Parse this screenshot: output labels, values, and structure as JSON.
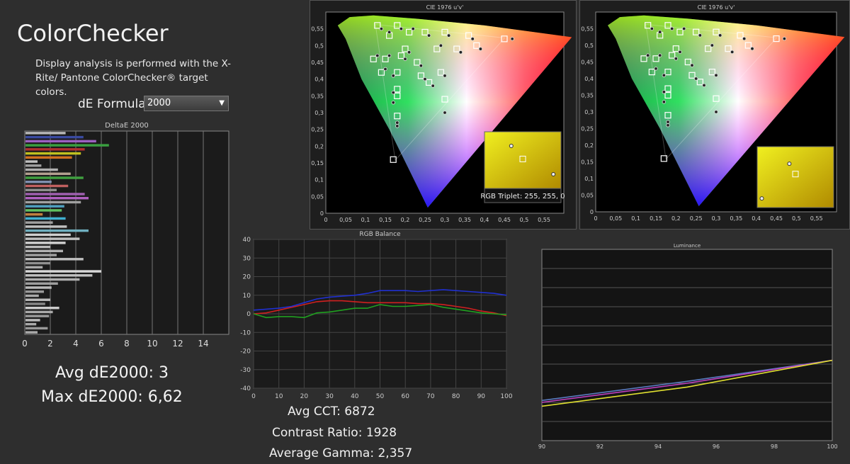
{
  "header": {
    "title": "ColorChecker",
    "description": "Display analysis is performed with the X-Rite/ Pantone ColorChecker® target colors.",
    "formula_label": "dE Formula:",
    "formula_value": "2000"
  },
  "stats": {
    "avg_de": "Avg dE2000: 3",
    "max_de": "Max dE2000: 6,62",
    "avg_cct": "Avg CCT: 6872",
    "contrast": "Contrast Ratio: 1928",
    "gamma": "Average Gamma: 2,357"
  },
  "cie": {
    "title": "CIE 1976 u'v'",
    "rgb_triplet": "RGB Triplet: 255, 255, 0",
    "x_ticks": [
      "0",
      "0,05",
      "0,1",
      "0,15",
      "0,2",
      "0,25",
      "0,3",
      "0,35",
      "0,4",
      "0,45",
      "0,5",
      "0,55"
    ],
    "y_ticks": [
      "0",
      "0,05",
      "0,1",
      "0,15",
      "0,2",
      "0,25",
      "0,3",
      "0,35",
      "0,4",
      "0,45",
      "0,5",
      "0,55"
    ]
  },
  "chart_data": [
    {
      "type": "bar",
      "title": "DeltaE 2000",
      "orientation": "horizontal",
      "xlim": [
        0,
        16
      ],
      "x_ticks": [
        "0",
        "2",
        "4",
        "6",
        "8",
        "10",
        "12",
        "14"
      ],
      "values": [
        3.2,
        4.6,
        5.6,
        6.6,
        4.7,
        4.4,
        3.7,
        1.0,
        1.3,
        2.6,
        3.6,
        4.6,
        2.1,
        3.4,
        2.5,
        4.7,
        5.0,
        4.4,
        3.1,
        2.9,
        1.4,
        3.2,
        2.2,
        3.3,
        5.0,
        3.6,
        4.3,
        3.2,
        2.0,
        3.0,
        2.5,
        4.6,
        2.0,
        1.4,
        6.0,
        5.3,
        4.3,
        2.6,
        2.1,
        1.5,
        1.1,
        2.0,
        1.6,
        2.7,
        2.2,
        1.9,
        1.2,
        0.9,
        1.8,
        1.0
      ],
      "colors": [
        "#b8b8b8",
        "#3a4aa0",
        "#9a60c0",
        "#3aa040",
        "#b03030",
        "#c0c020",
        "#d07020",
        "#c0c0c0",
        "#a0a0a0",
        "#b0b0b0",
        "#b3a090",
        "#40a040",
        "#8090b0",
        "#c06060",
        "#909090",
        "#a060b0",
        "#b060c0",
        "#a0a0a0",
        "#50a0c0",
        "#60c060",
        "#c08040",
        "#40b0d0",
        "#a0a0a0",
        "#c0c0c0",
        "#70b0c0",
        "#d0d0d0",
        "#c0c0c0",
        "#d0d0d0",
        "#bbbbbb",
        "#b0b0b0",
        "#a0a0a0",
        "#c0c0c0",
        "#909090",
        "#aaaaaa",
        "#d8d8d8",
        "#c0c0c0",
        "#b0b0b0",
        "#a0a0a0",
        "#bbbbbb",
        "#999999",
        "#aaaaaa",
        "#bbbbbb",
        "#888888",
        "#cccccc",
        "#aaaaaa",
        "#999999",
        "#bbbbbb",
        "#aaaaaa",
        "#999999",
        "#aaaaaa"
      ]
    },
    {
      "type": "line",
      "title": "RGB Balance",
      "x": [
        0,
        5,
        10,
        15,
        20,
        25,
        30,
        35,
        40,
        45,
        50,
        55,
        60,
        65,
        70,
        75,
        80,
        85,
        90,
        95,
        100
      ],
      "xlim": [
        0,
        100
      ],
      "ylim": [
        -40,
        40
      ],
      "x_ticks": [
        "0",
        "10",
        "20",
        "30",
        "40",
        "50",
        "60",
        "70",
        "80",
        "90",
        "100"
      ],
      "y_ticks": [
        "40",
        "30",
        "20",
        "10",
        "0",
        "-10",
        "-20",
        "-30",
        "-40"
      ],
      "series": [
        {
          "color": "#d02020",
          "values": [
            0,
            0.5,
            2,
            3.5,
            5,
            6.5,
            7,
            7,
            6.5,
            6,
            6,
            6,
            6,
            5.5,
            5.5,
            5,
            4,
            3,
            1.5,
            0.5,
            -1
          ]
        },
        {
          "color": "#20a020",
          "values": [
            0,
            -2,
            -1.5,
            -1.5,
            -2,
            0.5,
            1,
            2,
            3,
            3,
            5,
            4,
            4,
            4.5,
            5,
            3.5,
            2.5,
            1.5,
            0.5,
            0,
            -0.5
          ]
        },
        {
          "color": "#2030d0",
          "values": [
            2,
            2.5,
            3,
            4,
            6,
            8,
            9,
            9.5,
            10,
            11,
            12.5,
            12.5,
            12.5,
            12,
            12.5,
            13,
            12.5,
            12,
            11.5,
            11,
            10
          ]
        }
      ]
    },
    {
      "type": "line",
      "title": "Luminance",
      "x": [
        90,
        95,
        100
      ],
      "xlim": [
        90,
        100
      ],
      "ylim": [
        0,
        1
      ],
      "x_ticks": [
        "90",
        "92",
        "94",
        "96",
        "98",
        "100"
      ],
      "series": [
        {
          "color": "#5a7ac0",
          "values": [
            0.21,
            0.31,
            0.42
          ]
        },
        {
          "color": "#c040c0",
          "values": [
            0.2,
            0.3,
            0.42
          ]
        },
        {
          "color": "#e0e030",
          "values": [
            0.18,
            0.28,
            0.42
          ]
        }
      ]
    },
    {
      "type": "scatter",
      "title": "CIE 1976 u'v'",
      "xlim": [
        0,
        0.6
      ],
      "ylim": [
        0,
        0.6
      ],
      "targets": [
        [
          0.13,
          0.56
        ],
        [
          0.16,
          0.53
        ],
        [
          0.18,
          0.56
        ],
        [
          0.21,
          0.54
        ],
        [
          0.25,
          0.54
        ],
        [
          0.3,
          0.54
        ],
        [
          0.36,
          0.53
        ],
        [
          0.45,
          0.52
        ],
        [
          0.38,
          0.5
        ],
        [
          0.33,
          0.49
        ],
        [
          0.28,
          0.49
        ],
        [
          0.2,
          0.49
        ],
        [
          0.12,
          0.46
        ],
        [
          0.15,
          0.46
        ],
        [
          0.19,
          0.47
        ],
        [
          0.23,
          0.45
        ],
        [
          0.14,
          0.42
        ],
        [
          0.18,
          0.42
        ],
        [
          0.24,
          0.41
        ],
        [
          0.26,
          0.39
        ],
        [
          0.29,
          0.42
        ],
        [
          0.18,
          0.37
        ],
        [
          0.18,
          0.35
        ],
        [
          0.18,
          0.29
        ],
        [
          0.3,
          0.34
        ],
        [
          0.17,
          0.16
        ]
      ],
      "measured": [
        [
          0.14,
          0.55
        ],
        [
          0.16,
          0.54
        ],
        [
          0.19,
          0.55
        ],
        [
          0.22,
          0.55
        ],
        [
          0.26,
          0.53
        ],
        [
          0.31,
          0.53
        ],
        [
          0.37,
          0.52
        ],
        [
          0.47,
          0.52
        ],
        [
          0.39,
          0.49
        ],
        [
          0.34,
          0.48
        ],
        [
          0.29,
          0.5
        ],
        [
          0.21,
          0.48
        ],
        [
          0.13,
          0.47
        ],
        [
          0.16,
          0.47
        ],
        [
          0.2,
          0.46
        ],
        [
          0.24,
          0.44
        ],
        [
          0.15,
          0.43
        ],
        [
          0.17,
          0.41
        ],
        [
          0.25,
          0.4
        ],
        [
          0.27,
          0.38
        ],
        [
          0.3,
          0.41
        ],
        [
          0.17,
          0.36
        ],
        [
          0.17,
          0.33
        ],
        [
          0.18,
          0.27
        ],
        [
          0.3,
          0.3
        ],
        [
          0.18,
          0.26
        ]
      ]
    }
  ]
}
